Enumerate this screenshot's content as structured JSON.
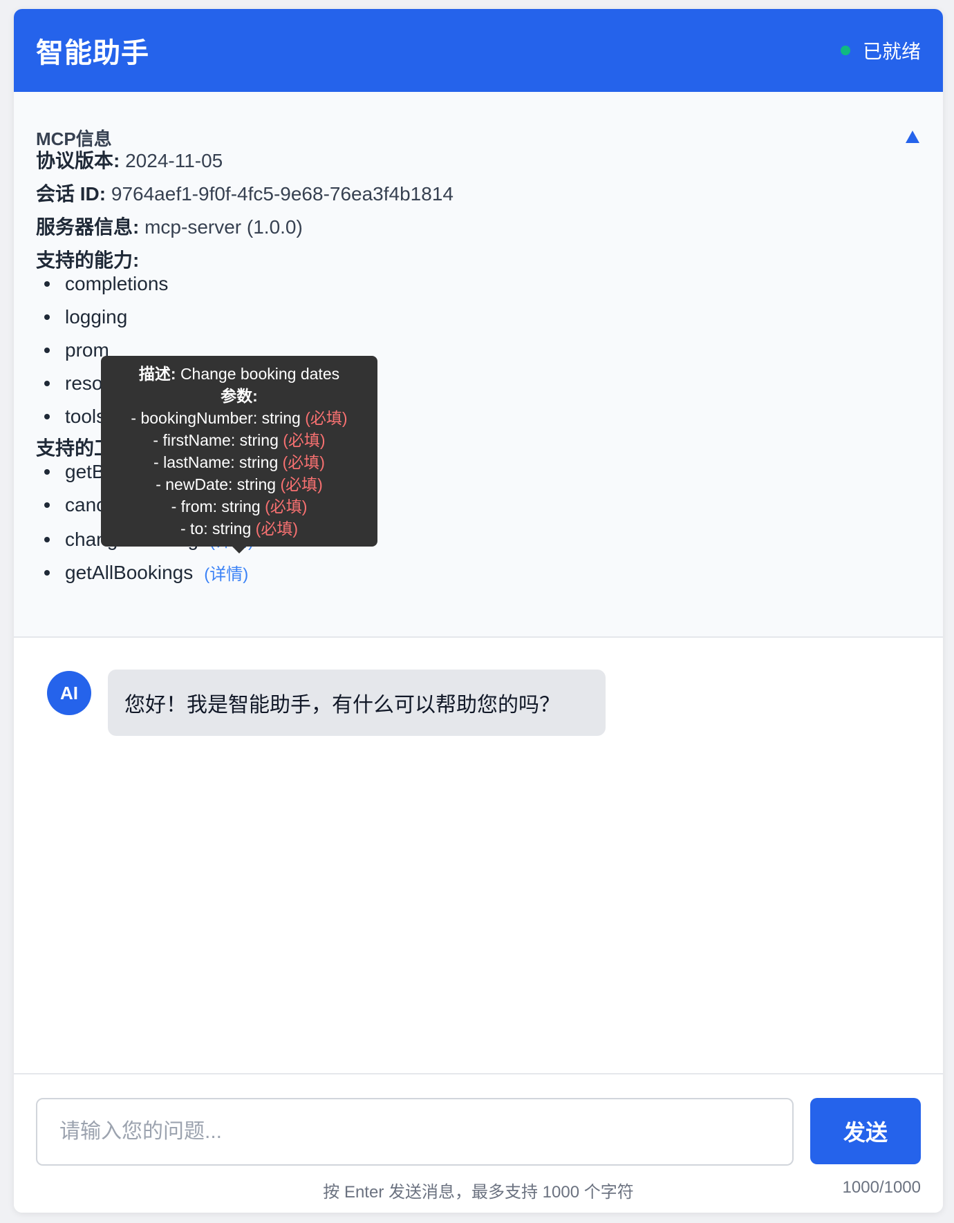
{
  "header": {
    "title": "智能助手",
    "status": "已就绪",
    "status_color": "#10b981",
    "brand_color": "#2563eb"
  },
  "mcp": {
    "title": "MCP信息",
    "toggle_icon": "triangle-up",
    "protocol_label": "协议版本:",
    "protocol_value": "2024-11-05",
    "session_label": "会话 ID:",
    "session_value": "9764aef1-9f0f-4fc5-9e68-76ea3f4b1814",
    "server_label": "服务器信息:",
    "server_value": "mcp-server (1.0.0)",
    "capabilities_label": "支持的能力:",
    "capabilities": [
      "completions",
      "logging",
      "prom",
      "reso",
      "tools"
    ],
    "tools_label": "支持的工",
    "tools": [
      {
        "name": "getB",
        "detail": ""
      },
      {
        "name": "canc",
        "detail": ""
      },
      {
        "name": "changeBooking",
        "detail": "(详情)"
      },
      {
        "name": "getAllBookings",
        "detail": "(详情)"
      }
    ],
    "tooltip": {
      "desc_label": "描述:",
      "desc_value": "Change booking dates",
      "params_label": "参数:",
      "params": [
        {
          "text": "- bookingNumber: string",
          "req": "(必填)"
        },
        {
          "text": "- firstName: string",
          "req": "(必填)"
        },
        {
          "text": "- lastName: string",
          "req": "(必填)"
        },
        {
          "text": "- newDate: string",
          "req": "(必填)"
        },
        {
          "text": "- from: string",
          "req": "(必填)"
        },
        {
          "text": "- to: string",
          "req": "(必填)"
        }
      ]
    }
  },
  "chat": {
    "messages": [
      {
        "avatar": "AI",
        "text": "您好！我是智能助手，有什么可以帮助您的吗？"
      }
    ]
  },
  "input": {
    "placeholder": "请输入您的问题...",
    "send_label": "发送",
    "hint": "按 Enter 发送消息，最多支持 1000 个字符",
    "counter": "1000/1000"
  }
}
